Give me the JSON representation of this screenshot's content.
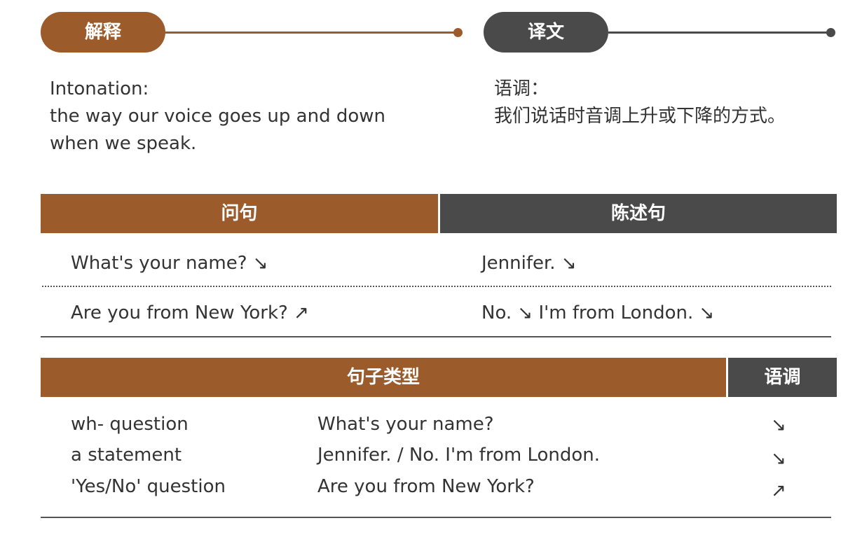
{
  "colors": {
    "accent": "#9c5b2b",
    "dark": "#4a4a4a",
    "text": "#333333"
  },
  "explain": {
    "label": "解释",
    "lines": [
      "Intonation:",
      "the way our voice goes up and down",
      "when we speak."
    ]
  },
  "translation": {
    "label": "译文",
    "lines": [
      "语调：",
      "我们说话时音调上升或下降的方式。"
    ]
  },
  "examples": {
    "headers": [
      "问句",
      "陈述句"
    ],
    "rows": [
      {
        "question": "What's your name? ↘",
        "answer": "Jennifer. ↘"
      },
      {
        "question": "Are you from New York? ↗",
        "answer": "No. ↘ I'm from London. ↘"
      }
    ]
  },
  "types": {
    "headers": [
      "句子类型",
      "语调"
    ],
    "rows": [
      {
        "type": "wh- question",
        "example": "What's your name?",
        "arrow": "↘"
      },
      {
        "type": "a statement",
        "example": "Jennifer. / No. I'm from London.",
        "arrow": "↘"
      },
      {
        "type": "'Yes/No' question",
        "example": "Are you from New York?",
        "arrow": "↗"
      }
    ]
  }
}
